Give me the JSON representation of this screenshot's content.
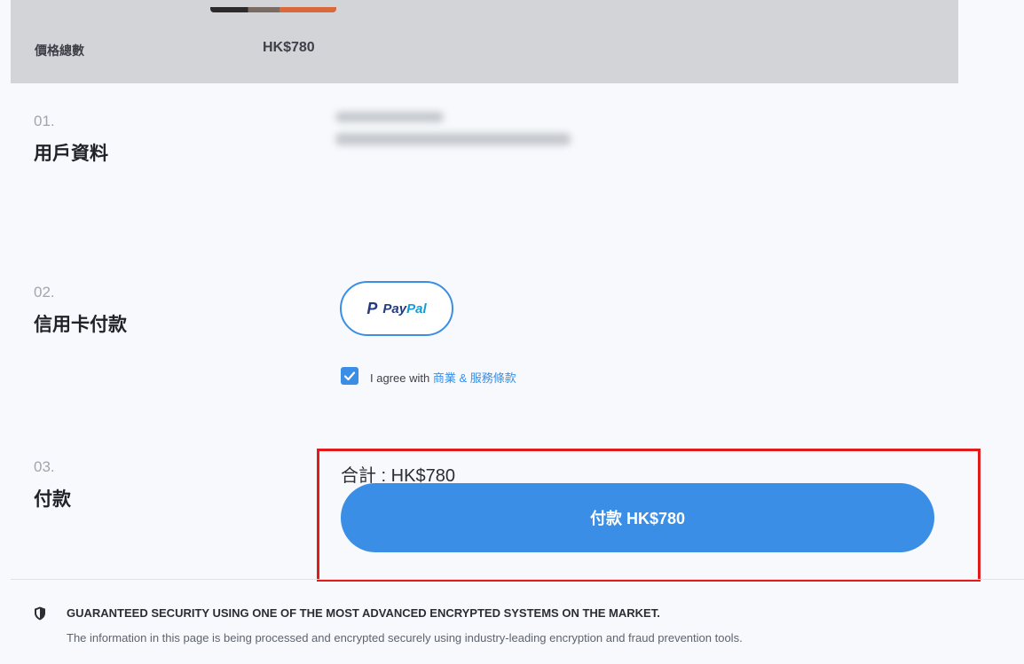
{
  "summary": {
    "label": "價格總數",
    "value": "HK$780"
  },
  "steps": [
    {
      "num": "01.",
      "title": "用戶資料"
    },
    {
      "num": "02.",
      "title": "信用卡付款"
    },
    {
      "num": "03.",
      "title": "付款"
    }
  ],
  "paypal": {
    "p_glyph": "P",
    "word_a": "Pay",
    "word_b": "Pal"
  },
  "agreement": {
    "prefix": "I agree with ",
    "link": "商業 & 服務條款",
    "checked": true
  },
  "payment": {
    "total_label": "合計 : HK$780",
    "button_label": "付款 HK$780"
  },
  "security": {
    "title": "GUARANTEED SECURITY USING ONE OF THE MOST ADVANCED ENCRYPTED SYSTEMS ON THE MARKET.",
    "body": "The information in this page is being processed and encrypted securely using industry-leading encryption and fraud prevention tools."
  },
  "colors": {
    "accent": "#3a8ee6",
    "highlight": "#e21b1b",
    "summary_bg": "#d3d4d8"
  },
  "icons": {
    "shield": "shield-icon",
    "check": "checkmark-icon"
  }
}
